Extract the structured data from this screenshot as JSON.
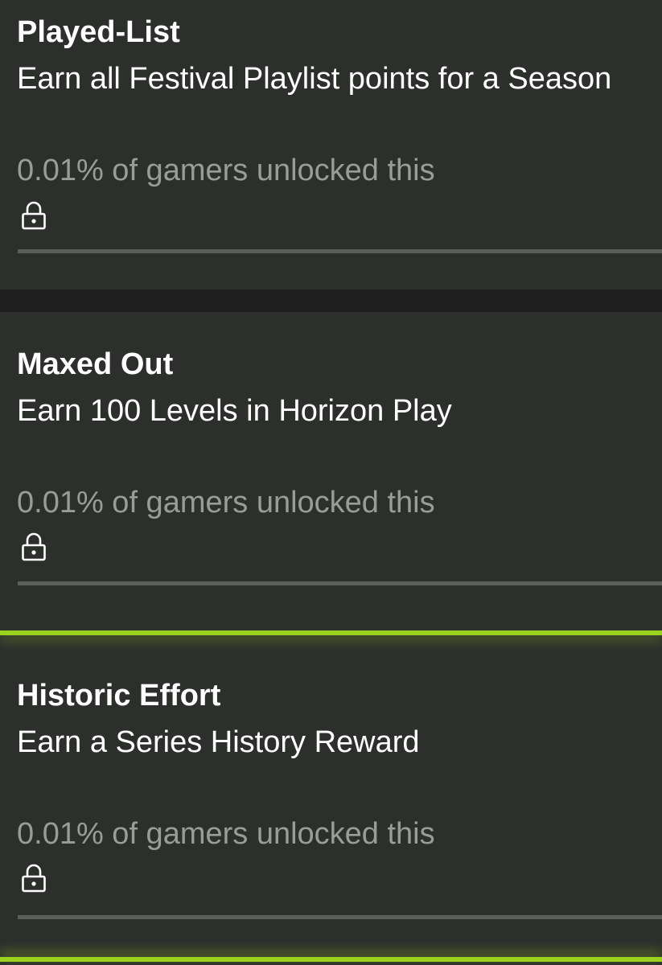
{
  "achievements": [
    {
      "title": "Played-List",
      "description": "Earn all Festival Playlist points for a Season",
      "rarity_text": "0.01% of gamers unlocked this",
      "icon": "lock-icon",
      "progress": 0
    },
    {
      "title": "Maxed Out",
      "description": "Earn 100 Levels in Horizon Play",
      "rarity_text": "0.01% of gamers unlocked this",
      "icon": "lock-icon",
      "progress": 0
    },
    {
      "title": "Historic Effort",
      "description": "Earn a Series History Reward",
      "rarity_text": "0.01% of gamers unlocked this",
      "icon": "lock-icon",
      "progress": 0,
      "selected": true
    }
  ],
  "colors": {
    "background": "#1e1f1e",
    "card": "#2d2f2d",
    "accent": "#9bd21f",
    "secondary_text": "#9a9c9a",
    "progress_track": "#5c5e5c"
  }
}
